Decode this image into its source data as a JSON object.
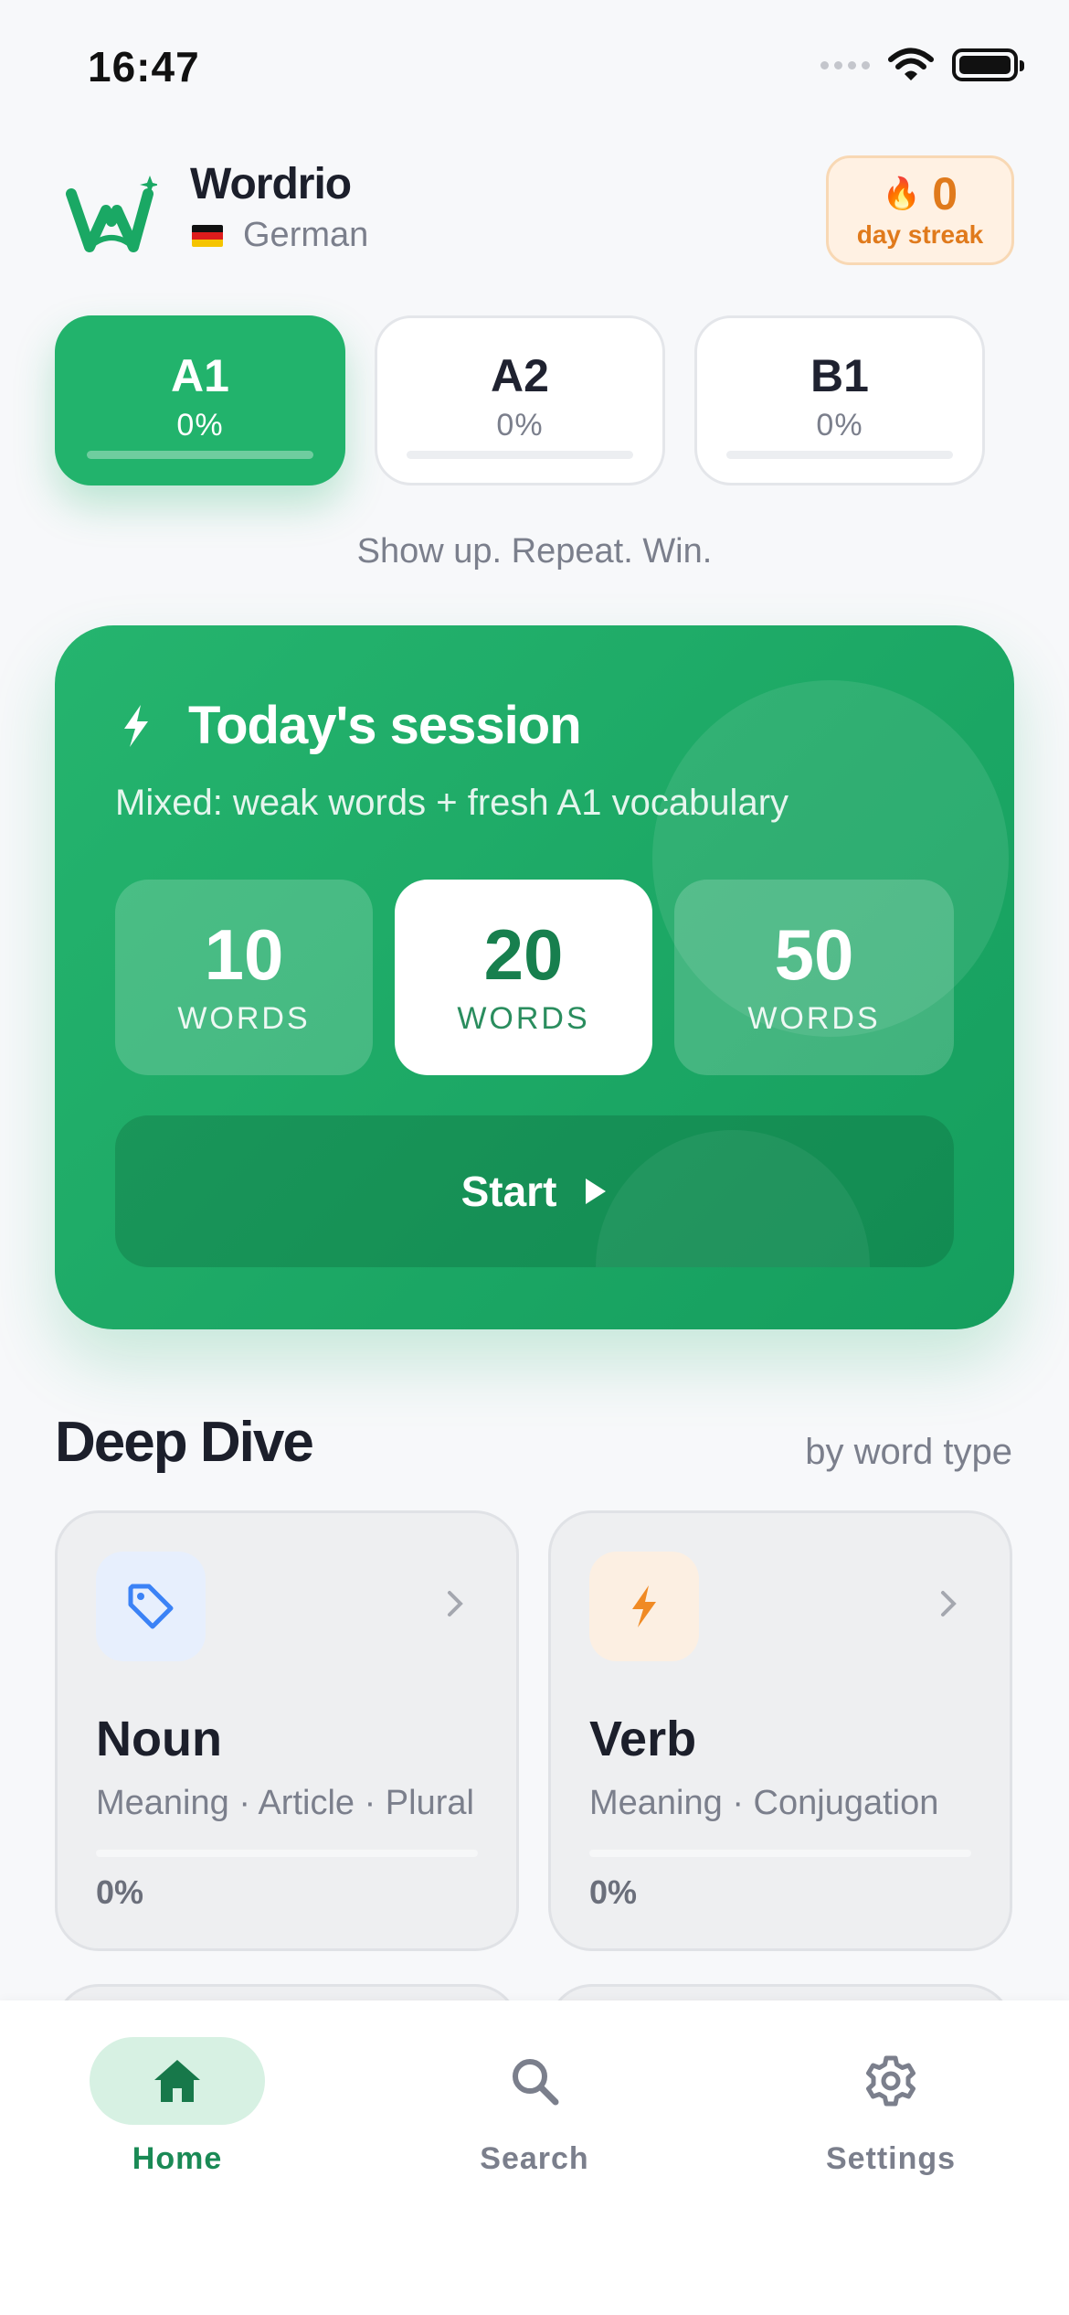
{
  "status_bar": {
    "time": "16:47"
  },
  "header": {
    "app_name": "Wordrio",
    "language": "German",
    "streak": {
      "count": "0",
      "label": "day streak"
    }
  },
  "levels": [
    {
      "name": "A1",
      "percent": "0%",
      "active": true
    },
    {
      "name": "A2",
      "percent": "0%",
      "active": false
    },
    {
      "name": "B1",
      "percent": "0%",
      "active": false
    }
  ],
  "tagline": "Show up. Repeat. Win.",
  "session": {
    "title": "Today's session",
    "subtitle": "Mixed: weak words + fresh A1 vocabulary",
    "options": [
      {
        "count": "10",
        "unit": "WORDS",
        "selected": false
      },
      {
        "count": "20",
        "unit": "WORDS",
        "selected": true
      },
      {
        "count": "50",
        "unit": "WORDS",
        "selected": false
      }
    ],
    "start_label": "Start"
  },
  "deep_dive": {
    "title": "Deep Dive",
    "subtitle": "by word type",
    "cards": [
      {
        "name": "Noun",
        "desc": "Meaning · Article · Plural",
        "percent": "0%",
        "icon": "tag-icon",
        "accent": "#3b82f6"
      },
      {
        "name": "Verb",
        "desc": "Meaning · Conjugation",
        "percent": "0%",
        "icon": "lightning-icon",
        "accent": "#f08a24"
      }
    ]
  },
  "tabs": [
    {
      "label": "Home",
      "icon": "home-icon",
      "active": true
    },
    {
      "label": "Search",
      "icon": "search-icon",
      "active": false
    },
    {
      "label": "Settings",
      "icon": "gear-icon",
      "active": false
    }
  ],
  "colors": {
    "brand": "#22b36c",
    "streak": "#e07a1c"
  }
}
